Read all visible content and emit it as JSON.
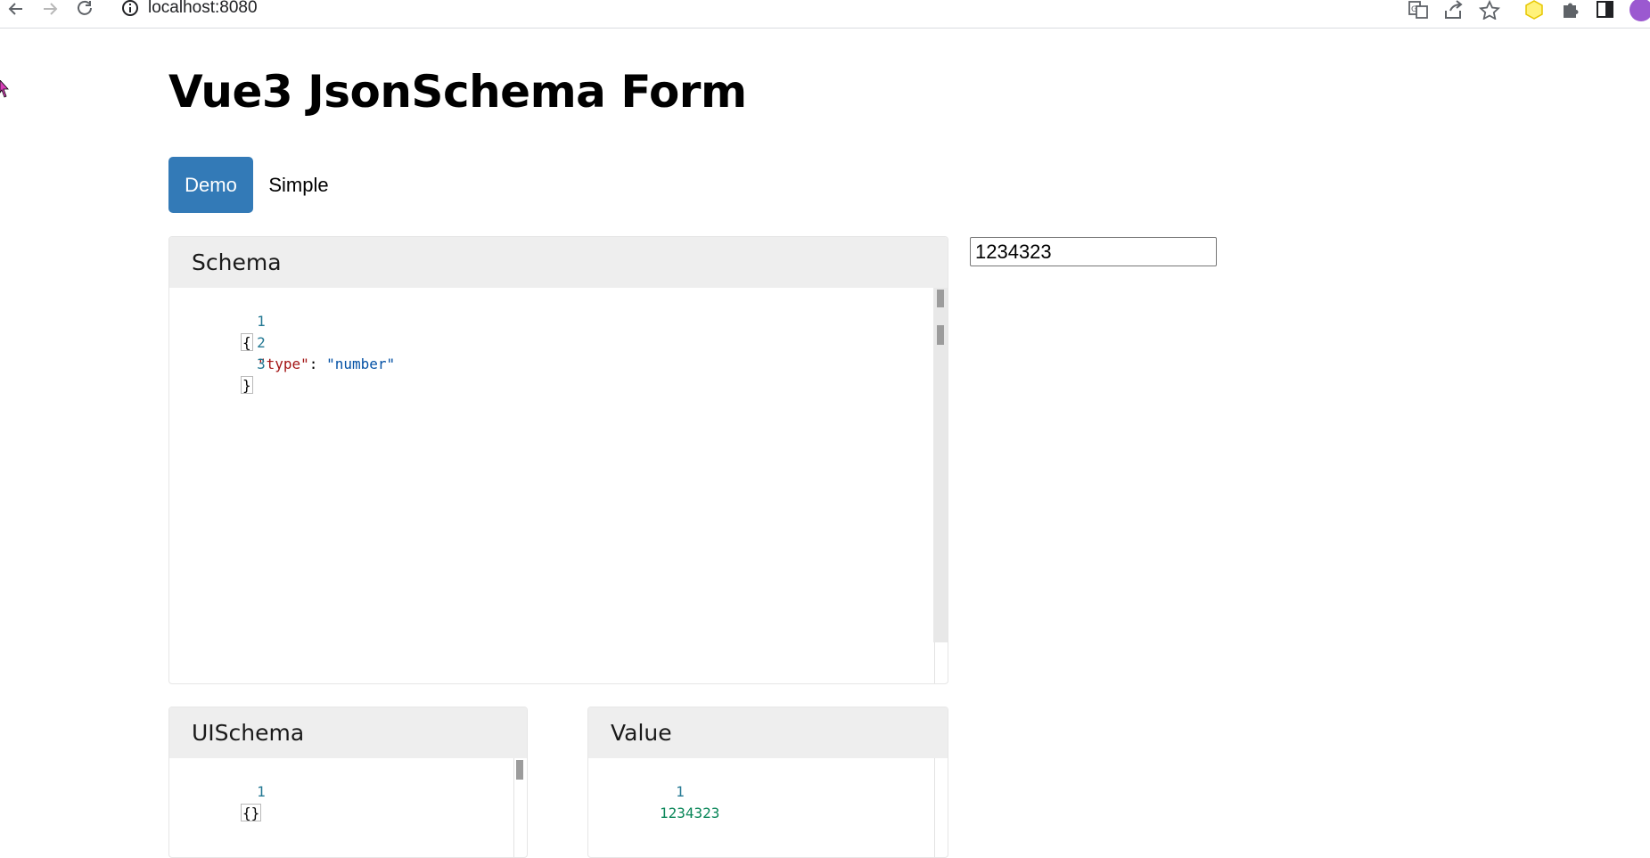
{
  "browser": {
    "url": "localhost:8080"
  },
  "page": {
    "title": "Vue3 JsonSchema Form",
    "tabs": [
      {
        "label": "Demo",
        "active": true
      },
      {
        "label": "Simple",
        "active": false
      }
    ]
  },
  "schema_panel": {
    "title": "Schema",
    "line_numbers": [
      "1",
      "2",
      "3"
    ],
    "open_brace": "{",
    "key": "\"type\"",
    "colon": ": ",
    "value": "\"number\"",
    "close_brace": "}"
  },
  "uischema_panel": {
    "title": "UISchema",
    "line_numbers": [
      "1"
    ],
    "content": "{}"
  },
  "value_panel": {
    "title": "Value",
    "line_numbers": [
      "1"
    ],
    "content": "1234323"
  },
  "form": {
    "number_value": "1234323"
  },
  "colors": {
    "active_tab": "#337ab7",
    "panel_header": "#eeeeee",
    "json_key": "#a31515",
    "json_string": "#0451a5",
    "json_number": "#098658",
    "line_number": "#237893"
  }
}
